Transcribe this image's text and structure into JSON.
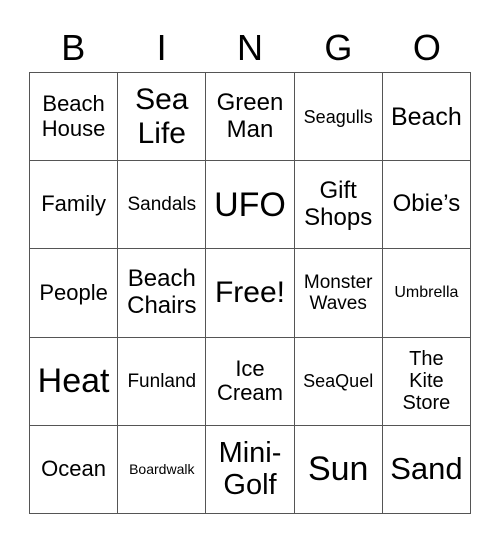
{
  "header": [
    "B",
    "I",
    "N",
    "G",
    "O"
  ],
  "cells": [
    "Beach\nHouse",
    "Sea\nLife",
    "Green\nMan",
    "Seagulls",
    "Beach",
    "Family",
    "Sandals",
    "UFO",
    "Gift\nShops",
    "Obie’s",
    "People",
    "Beach\nChairs",
    "Free!",
    "Monster\nWaves",
    "Umbrella",
    "Heat",
    "Funland",
    "Ice\nCream",
    "SeaQuel",
    "The\nKite\nStore",
    "Ocean",
    "Boardwalk",
    "Mini-\nGolf",
    "Sun",
    "Sand"
  ]
}
